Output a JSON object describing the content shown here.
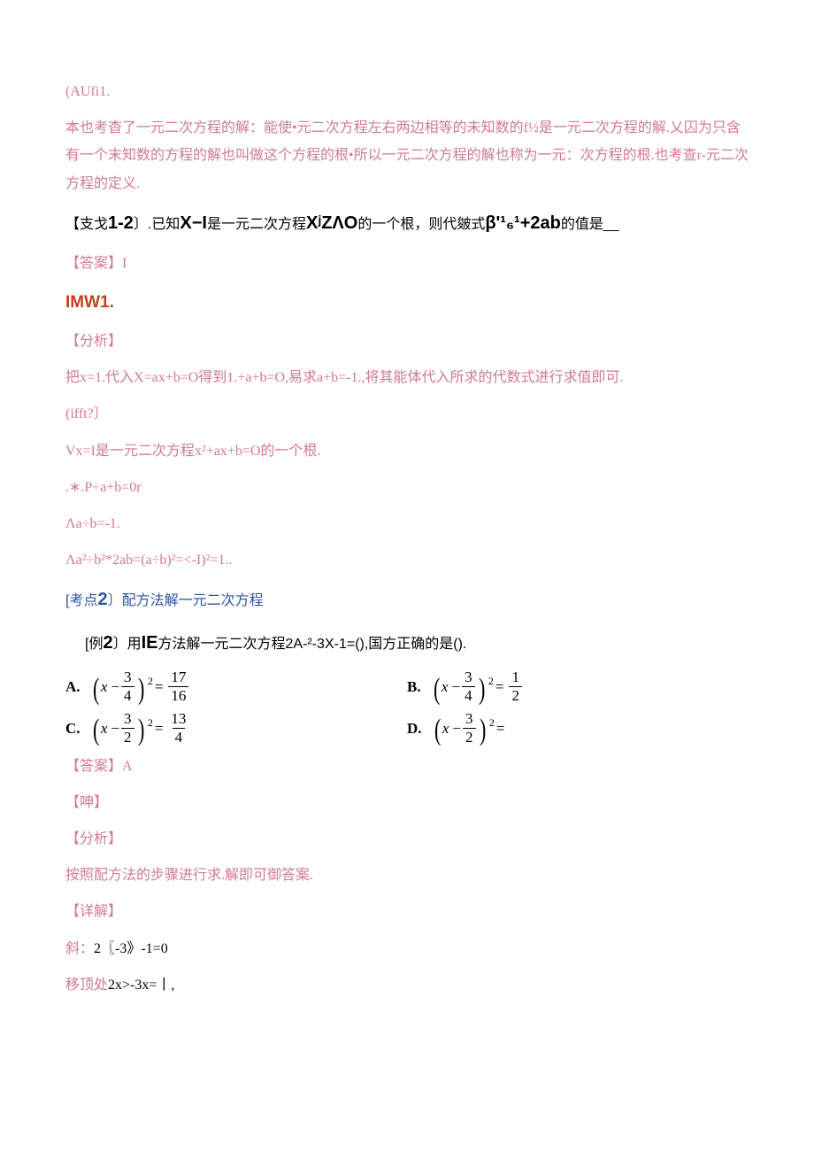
{
  "p1": "(AUfi1.",
  "p2": "本也考杳了一元二次方程的解：能使•元二次方程左右两边相等的未知数的f½是一元二次方程的解.乂囚为只含有一个末知数的方程的解也叫做这个方程的根•所以一元二次方程的解也称为一元：次方程的根.也考查r-元二次方程的定义.",
  "p3_prefix": "【支戈",
  "p3_num": "1-2",
  "p3_mid": "〕.已知",
  "p3_b1": "X−I",
  "p3_mid2": "是一元二次方程",
  "p3_b2": "XʲZΛO",
  "p3_mid3": "的一个根，则代皴式",
  "p3_b3": "β'¹₆¹+2ab",
  "p3_tail": "的值是__",
  "p4": "【答案】I",
  "p5": "IMW1.",
  "p6": "【分析】",
  "p7": "把x=1.代入X=ax+b=O得到1.+a+b=O,易求a+b=-1.,将其能体代入所求的代数式进行求值即可.",
  "p8": "(ifft?〕",
  "p9": "Vx=I是一元二次方程x²+ax+b=O的一个根.",
  "p10": ".∗.P÷a+b=0r",
  "p11": "Λa÷b=-1.",
  "p12": "Λa²÷b²*2ab=(a÷b)²=<-I)²=1..",
  "topic2_prefix": "[考点",
  "topic2_num": "2",
  "topic2_suffix": "〕配方法解一元二次方程",
  "ex2_prefix": "[例",
  "ex2_num": "2",
  "ex2_mid": "〕用",
  "ex2_b1": "IE",
  "ex2_tail": "方法解一元二次方程2A-²-3X-1=(),国方正确的是().",
  "options": {
    "A": {
      "left_inner_num": "3",
      "left_inner_den": "4",
      "right_num": "17",
      "right_den": "16"
    },
    "B": {
      "left_inner_num": "3",
      "left_inner_den": "4",
      "right_num": "1",
      "right_den": "2"
    },
    "C": {
      "left_inner_num": "3",
      "left_inner_den": "2",
      "right_num": "13",
      "right_den": "4"
    },
    "D": {
      "left_inner_num": "3",
      "left_inner_den": "2"
    }
  },
  "ans": "【答案】A",
  "shen": "【呻】",
  "fenxi": "【分析】",
  "fenxi_body": "按照配方法的步骤进行求.解即可御答案.",
  "xiangjie": "【详解】",
  "xj1_a": "斜：",
  "xj1_b": "2〖-3》-1=0",
  "xj2_a": "移顶处",
  "xj2_b": "2x>-3x=丨,"
}
